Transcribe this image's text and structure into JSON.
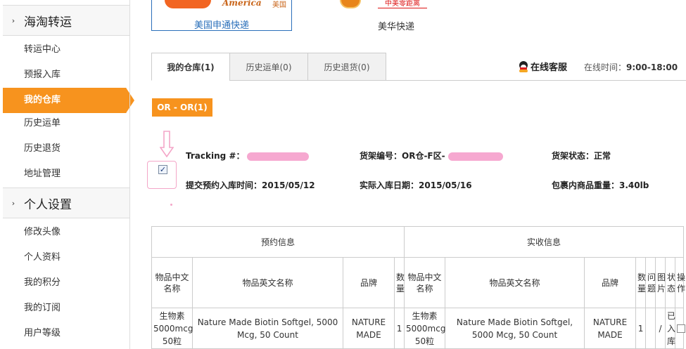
{
  "sidebar": {
    "group1": "海淘转运",
    "items1": [
      "转运中心",
      "预报入库",
      "我的仓库",
      "历史运单",
      "历史退货",
      "地址管理"
    ],
    "group2": "个人设置",
    "items2": [
      "修改头像",
      "个人资料",
      "我的积分",
      "我的订阅",
      "用户等级"
    ],
    "arrow_icon": "›",
    "active_index": 2
  },
  "logos": {
    "logo1_text": "America",
    "logo1_cn_small": "美国",
    "logo1_name": "美国申通快递",
    "logo2_tag": "中美零距离",
    "logo2_name": "美华快递"
  },
  "tabs": [
    "我的仓库(1)",
    "历史运单(0)",
    "历史退货(0)"
  ],
  "service": {
    "label": "在线客服",
    "time_label": "在线时间：",
    "time_value": "9:00-18:00"
  },
  "warehouse": {
    "tag": "OR - OR(1)",
    "tracking_label": "Tracking #：",
    "shelf_label": "货架编号：OR仓-F区-",
    "shelf_status_label": "货架状态：",
    "shelf_status_value": "正常",
    "submit_time_label": "提交预约入库时间：",
    "submit_time_value": "2015/05/12",
    "actual_date_label": "实际入库日期：",
    "actual_date_value": "2015/05/16",
    "weight_label": "包裹内商品重量：",
    "weight_value": "3.40lb",
    "checkbox_mark": "✓"
  },
  "table": {
    "group_headers": [
      "预约信息",
      "实收信息"
    ],
    "columns_booking": [
      "物品中文名称",
      "物品英文名称",
      "品牌",
      "数量"
    ],
    "columns_received": [
      "物品中文名称",
      "物品英文名称",
      "品牌",
      "数量",
      "问题",
      "图片",
      "状态",
      "操作"
    ],
    "rows": [
      {
        "cn_name": "生物素5000mcg 50粒",
        "en_name": "Nature Made Biotin Softgel, 5000 Mcg, 50 Count",
        "brand": "NATURE MADE",
        "qty": "1",
        "r_cn_name": "生物素5000mcg 50粒",
        "r_en_name": "Nature Made Biotin Softgel, 5000 Mcg, 50 Count",
        "r_brand": "NATURE MADE",
        "r_qty": "1",
        "problem": "",
        "image": "/",
        "status": "已入库"
      }
    ]
  }
}
